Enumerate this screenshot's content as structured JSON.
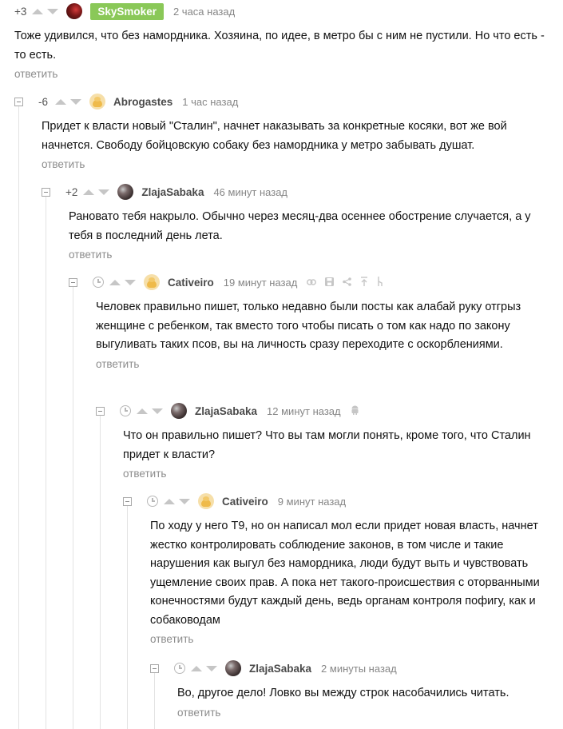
{
  "reply_label": "ответить",
  "comments": [
    {
      "rating": "+3",
      "username": "SkySmoker",
      "time": "2 часа назад",
      "text": "Тоже удивился, что без намордника. Хозяина, по идее, в метро бы с ним не пустили. Но что есть - то есть."
    },
    {
      "rating": "-6",
      "username": "Abrogastes",
      "time": "1 час назад",
      "text": "Придет к власти новый \"Сталин\", начнет наказывать за конкретные косяки, вот же вой начнется. Свободу бойцовскую собаку без намордника у метро забывать душат."
    },
    {
      "rating": "+2",
      "username": "ZlajaSabaka",
      "time": "46 минут назад",
      "text": "Рановато тебя накрыло. Обычно через месяц-два осеннее обострение случается, а у тебя в последний день лета."
    },
    {
      "rating": "",
      "username": "Cativeiro",
      "time": "19 минут назад",
      "text": "Человек правильно пишет, только недавно были посты как алабай руку отгрыз женщине с ребенком, так вместо того чтобы писать о том как надо по закону выгуливать таких псов, вы на личность сразу переходите с оскорблениями."
    },
    {
      "rating": "",
      "username": "ZlajaSabaka",
      "time": "12 минут назад",
      "text": "Что он правильно пишет? Что вы там могли понять, кроме того, что Сталин придет к власти?"
    },
    {
      "rating": "",
      "username": "Cativeiro",
      "time": "9 минут назад",
      "text": "По ходу у него Т9, но он написал мол если придет новая власть, начнет жестко контролировать соблюдение законов, в том числе и такие нарушения как выгул без намордника, люди будут выть и чувствовать ущемление своих прав.  А пока нет такого-происшествия с оторванными конечностями будут каждый день, ведь органам контроля пофигу, как и собаководам"
    },
    {
      "rating": "",
      "username": "ZlajaSabaka",
      "time": "2 минуты назад",
      "text": "Во, другое дело! Ловко вы между строк насобачились читать."
    }
  ],
  "colors": {
    "badge_green": "#8ac858",
    "reply_gray": "#8c8c8c",
    "thread_line": "#e3e3e3"
  },
  "icons": {
    "collapse": "collapse-minus-icon",
    "vote_up": "upvote-arrow-icon",
    "vote_down": "downvote-arrow-icon",
    "clock": "clock-icon",
    "link": "link-icon",
    "save": "save-icon",
    "share": "share-icon",
    "up": "scroll-up-icon",
    "branch": "branch-icon",
    "android": "android-icon"
  }
}
